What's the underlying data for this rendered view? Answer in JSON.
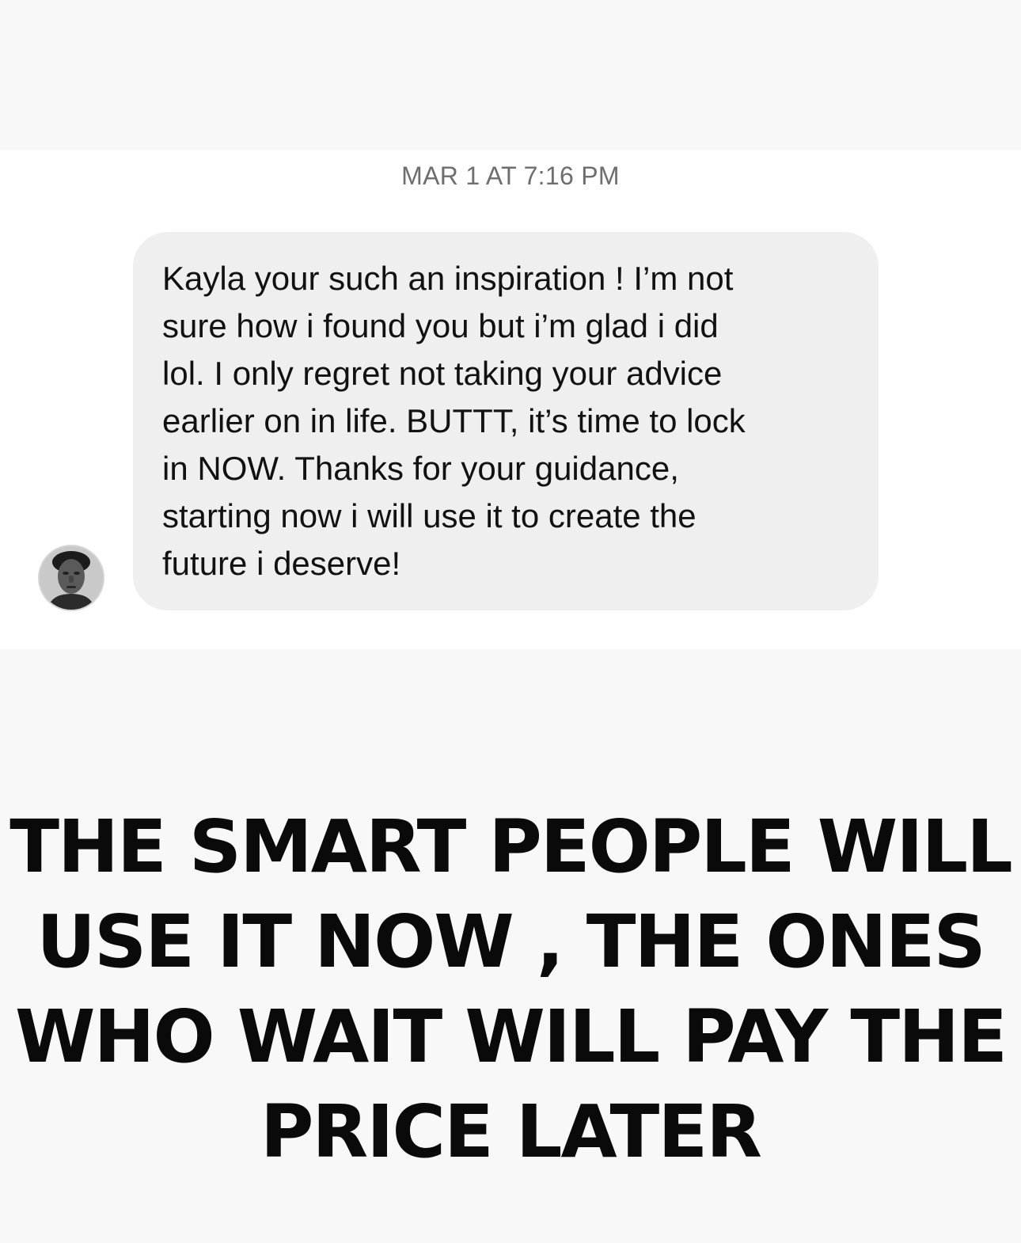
{
  "conversation": {
    "timestamp": "MAR 1 AT 7:16 PM",
    "message": {
      "sender_avatar_icon": "user-avatar-photo",
      "text": "Kayla your such an inspiration ! I’m not\nsure how i found you but i’m glad i did\nlol. I only regret not taking your advice\nearlier on in life. BUTTT, it’s time to lock\nin NOW. Thanks for your guidance,\nstarting now i will use it to create the\nfuture i deserve!"
    }
  },
  "caption": {
    "text": "THE SMART PEOPLE WILL\nUSE IT NOW , THE ONES\nWHO WAIT WILL PAY THE\nPRICE LATER"
  },
  "colors": {
    "background": "#f8f8f8",
    "message_area": "#ffffff",
    "bubble": "#efefef",
    "timestamp_text": "#6e6e6e",
    "message_text": "#111111",
    "caption_text": "#0a0a0a"
  }
}
